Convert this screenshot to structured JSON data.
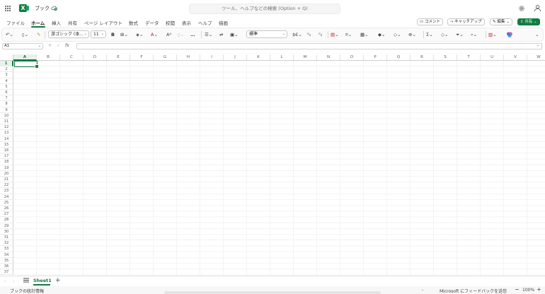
{
  "titlebar": {
    "book_title": "ブック",
    "search_placeholder": "ツール、ヘルプなどの検索 (Option + Q)"
  },
  "menu_tabs": [
    {
      "label": "ファイル"
    },
    {
      "label": "ホーム"
    },
    {
      "label": "挿入"
    },
    {
      "label": "共有"
    },
    {
      "label": "ページ レイアウト"
    },
    {
      "label": "数式"
    },
    {
      "label": "データ"
    },
    {
      "label": "校閲"
    },
    {
      "label": "表示"
    },
    {
      "label": "ヘルプ"
    },
    {
      "label": "描画"
    }
  ],
  "active_tab": "ホーム",
  "header_buttons": {
    "comment": "コメント",
    "catchup": "キャッチアップ",
    "edit": "編集",
    "share": "共有"
  },
  "ribbon": {
    "font_name": "游ゴシック (本...",
    "font_size": "11",
    "bold": "B",
    "more": "…",
    "number_format": "標準",
    "currency": "$€"
  },
  "formula_bar": {
    "name_box": "A1",
    "fx": "fx",
    "formula": ""
  },
  "grid": {
    "columns": [
      "A",
      "B",
      "C",
      "D",
      "E",
      "F",
      "G",
      "H",
      "I",
      "J",
      "K",
      "L",
      "M",
      "N",
      "O",
      "P",
      "Q",
      "R",
      "S",
      "T",
      "U",
      "V",
      "W"
    ],
    "rows": [
      "1",
      "2",
      "3",
      "4",
      "5",
      "6",
      "7",
      "8",
      "9",
      "10",
      "11",
      "12",
      "13",
      "14",
      "15",
      "16",
      "17",
      "18",
      "19",
      "20",
      "21",
      "22",
      "23",
      "24",
      "25",
      "26",
      "27",
      "28",
      "29",
      "30",
      "31",
      "32",
      "33",
      "34",
      "35",
      "36",
      "37"
    ],
    "selected_cell": "A1"
  },
  "sheets": {
    "tabs": [
      "Sheet1"
    ],
    "add": "+"
  },
  "status": {
    "left": "ブックの統計情報",
    "dash": "-",
    "feedback": "Microsoft にフィードバックを送信",
    "zoom_minus": "−",
    "zoom": "100%",
    "zoom_plus": "+"
  },
  "colors": {
    "accent": "#107c41",
    "gridline": "#ececec",
    "ribbon_bg": "#fafafa"
  }
}
